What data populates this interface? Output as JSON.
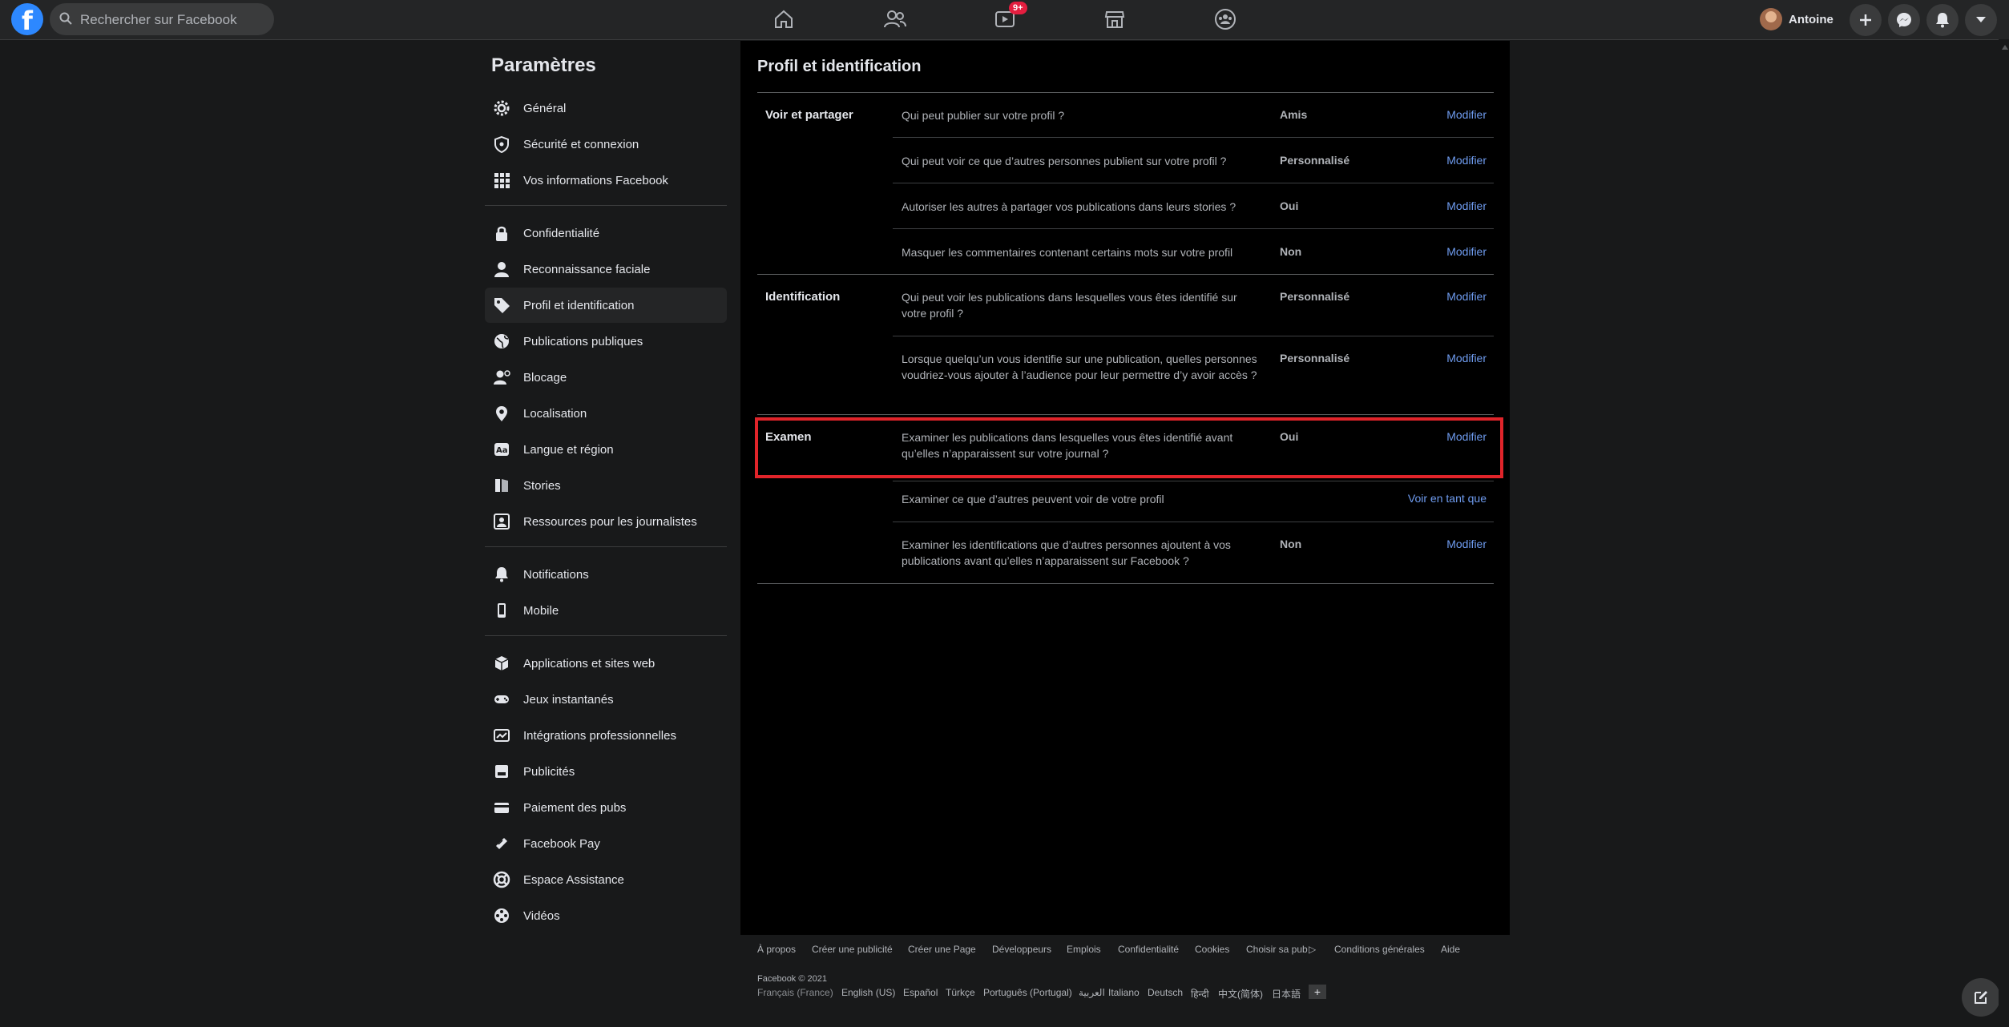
{
  "topbar": {
    "search_placeholder": "Rechercher sur Facebook",
    "watch_badge": "9+",
    "profile_name": "Antoine"
  },
  "sidebar": {
    "title": "Paramètres",
    "items": [
      {
        "label": "Général",
        "icon": "gear-icon"
      },
      {
        "label": "Sécurité et connexion",
        "icon": "shield-icon"
      },
      {
        "label": "Vos informations Facebook",
        "icon": "grid-icon"
      },
      {
        "label": "Confidentialité",
        "icon": "lock-icon"
      },
      {
        "label": "Reconnaissance faciale",
        "icon": "person-icon"
      },
      {
        "label": "Profil et identification",
        "icon": "tag-icon"
      },
      {
        "label": "Publications publiques",
        "icon": "globe-icon"
      },
      {
        "label": "Blocage",
        "icon": "block-user-icon"
      },
      {
        "label": "Localisation",
        "icon": "location-pin-icon"
      },
      {
        "label": "Langue et région",
        "icon": "language-icon"
      },
      {
        "label": "Stories",
        "icon": "book-icon"
      },
      {
        "label": "Ressources pour les journalistes",
        "icon": "journalist-icon"
      },
      {
        "label": "Notifications",
        "icon": "bell-icon"
      },
      {
        "label": "Mobile",
        "icon": "mobile-icon"
      },
      {
        "label": "Applications et sites web",
        "icon": "cube-icon"
      },
      {
        "label": "Jeux instantanés",
        "icon": "gamepad-icon"
      },
      {
        "label": "Intégrations professionnelles",
        "icon": "business-icon"
      },
      {
        "label": "Publicités",
        "icon": "ads-icon"
      },
      {
        "label": "Paiement des pubs",
        "icon": "card-icon"
      },
      {
        "label": "Facebook Pay",
        "icon": "pay-icon"
      },
      {
        "label": "Espace Assistance",
        "icon": "lifebuoy-icon"
      },
      {
        "label": "Vidéos",
        "icon": "film-icon"
      }
    ],
    "active_index": 5
  },
  "main": {
    "title": "Profil et identification",
    "sections": [
      {
        "label": "Voir et partager",
        "rows": [
          {
            "question": "Qui peut publier sur votre profil ?",
            "value": "Amis",
            "action": "Modifier"
          },
          {
            "question": "Qui peut voir ce que d’autres personnes publient sur votre profil ?",
            "value": "Personnalisé",
            "action": "Modifier"
          },
          {
            "question": "Autoriser les autres à partager vos publications dans leurs stories ?",
            "value": "Oui",
            "action": "Modifier"
          },
          {
            "question": "Masquer les commentaires contenant certains mots sur votre profil",
            "value": "Non",
            "action": "Modifier"
          }
        ]
      },
      {
        "label": "Identification",
        "rows": [
          {
            "question": "Qui peut voir les publications dans lesquelles vous êtes identifié sur votre profil ?",
            "value": "Personnalisé",
            "action": "Modifier"
          },
          {
            "question": "Lorsque quelqu’un vous identifie sur une publication, quelles personnes voudriez-vous ajouter à l’audience pour leur permettre d’y avoir accès ?",
            "value": "Personnalisé",
            "action": "Modifier"
          }
        ]
      },
      {
        "label": "Examen",
        "rows": [
          {
            "question": "Examiner les publications dans lesquelles vous êtes identifié avant qu’elles n’apparaissent sur votre journal ?",
            "value": "Oui",
            "action": "Modifier"
          },
          {
            "question": "Examiner ce que d’autres peuvent voir de votre profil",
            "value": "",
            "action": "Voir en tant que"
          },
          {
            "question": "Examiner les identifications que d’autres personnes ajoutent à vos publications avant qu’elles n’apparaissent sur Facebook ?",
            "value": "Non",
            "action": "Modifier"
          }
        ]
      }
    ]
  },
  "footer": {
    "links": [
      "À propos",
      "Créer une publicité",
      "Créer une Page",
      "Développeurs",
      "Emplois",
      "Confidentialité",
      "Cookies",
      "Choisir sa pub",
      "Conditions générales",
      "Aide"
    ],
    "copyright": "Facebook © 2021",
    "languages": [
      "Français (France)",
      "English (US)",
      "Español",
      "Türkçe",
      "Português (Portugal)",
      "العربية",
      "Italiano",
      "Deutsch",
      "हिन्दी",
      "中文(简体)",
      "日本語"
    ],
    "add_language": "+"
  },
  "colors": {
    "accent_link": "#6f9cf0",
    "highlight_border": "#e0242a",
    "badge": "#e41e3f",
    "brand": "#2d88ff"
  }
}
